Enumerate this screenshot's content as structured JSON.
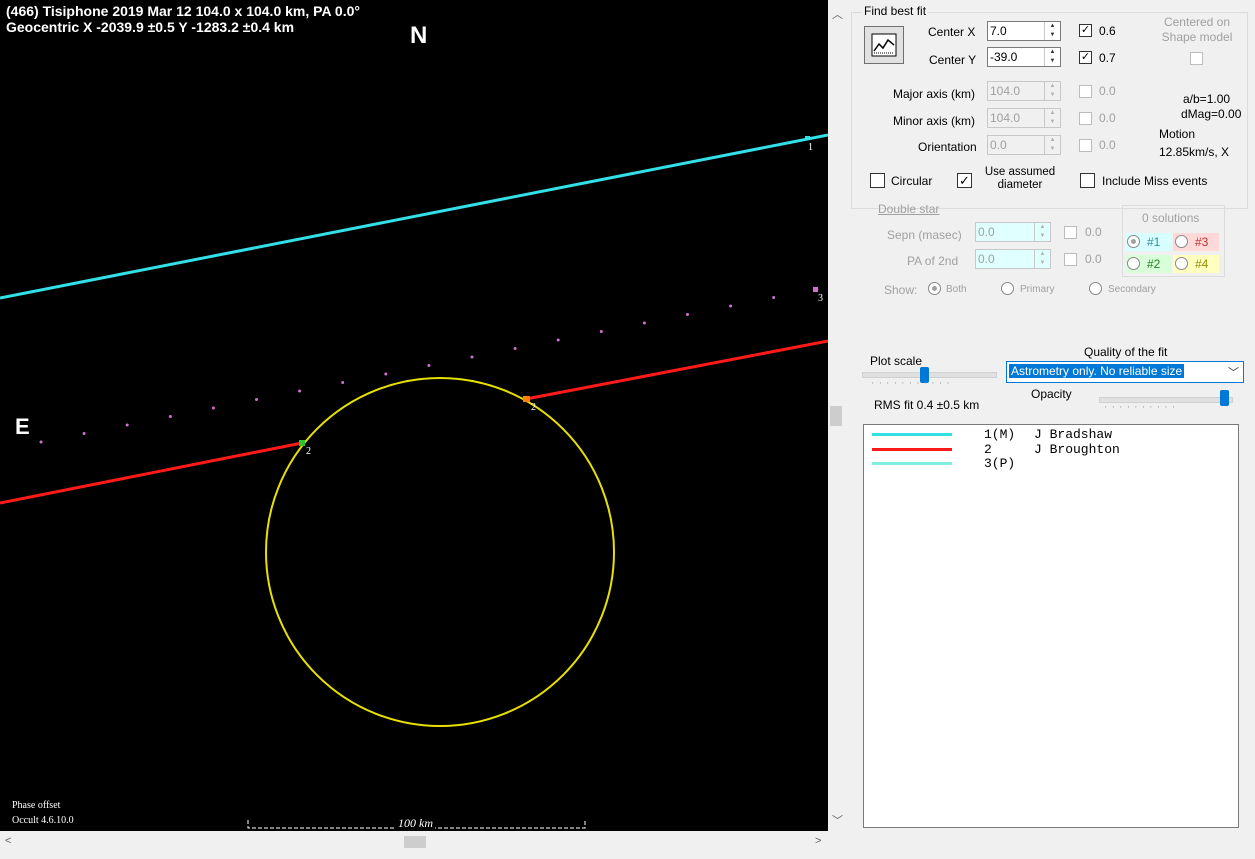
{
  "plot": {
    "header_line1": "(466) Tisiphone 2019 Mar 12  104.0 x 104.0 km, PA 0.0°",
    "header_line2": "Geocentric X  -2039.9 ±0.5  Y -1283.2 ±0.4 km",
    "north_label": "N",
    "east_label": "E",
    "chord_labels": [
      "1",
      "2",
      "2",
      "3"
    ],
    "phase_offset": "Phase offset",
    "version": "Occult 4.6.10.0",
    "scale_label": "100 km",
    "colors": {
      "background": "#000000",
      "chord1": "#33e0e8",
      "chord2": "#ff1a1a",
      "ellipse": "#e8e000",
      "chord3_dots": "#d070d0"
    }
  },
  "panel": {
    "find_best_fit_title": "Find best fit",
    "fit_icon": "chart-fit-icon",
    "center_x_label": "Center X",
    "center_x_value": "7.0",
    "center_y_label": "Center Y",
    "center_y_value": "-39.0",
    "center_x_check_value": "0.6",
    "center_y_check_value": "0.7",
    "centered_on_shape": "Centered on Shape model",
    "major_axis_label": "Major axis (km)",
    "major_axis_value": "104.0",
    "minor_axis_label": "Minor axis (km)",
    "minor_axis_value": "104.0",
    "orientation_label": "Orientation",
    "orientation_value": "0.0",
    "disabled_check_value": "0.0",
    "ab_ratio": "a/b=1.00",
    "dmag": "dMag=0.00",
    "motion_label": "Motion",
    "motion_value": "12.85km/s, X",
    "circular_label": "Circular",
    "use_assumed_label": "Use assumed diameter",
    "include_miss_label": "Include Miss events",
    "double_star_label": "Double star",
    "sepn_label": "Sepn (masec)",
    "sepn_value": "0.0",
    "pa2nd_label": "PA of 2nd",
    "pa2nd_value": "0.0",
    "solutions_label": "0 solutions",
    "solutions": [
      "#1",
      "#3",
      "#2",
      "#4"
    ],
    "show_label": "Show:",
    "show_options": [
      "Both",
      "Primary",
      "Secondary"
    ],
    "plot_scale_label": "Plot scale",
    "quality_label": "Quality of the fit",
    "quality_value": "Astrometry only. No reliable size",
    "opacity_label": "Opacity",
    "rms_fit": "RMS fit 0.4 ±0.5 km",
    "plot_scale_level": 0.5,
    "opacity_level": 0.98
  },
  "legend": [
    {
      "id": "1(M)",
      "name": "J Bradshaw",
      "color": "#33e0e8"
    },
    {
      "id": "2",
      "name": "J Broughton",
      "color": "#ff1a1a"
    },
    {
      "id": "3(P)",
      "name": "",
      "color": "#7ff0e0"
    }
  ]
}
